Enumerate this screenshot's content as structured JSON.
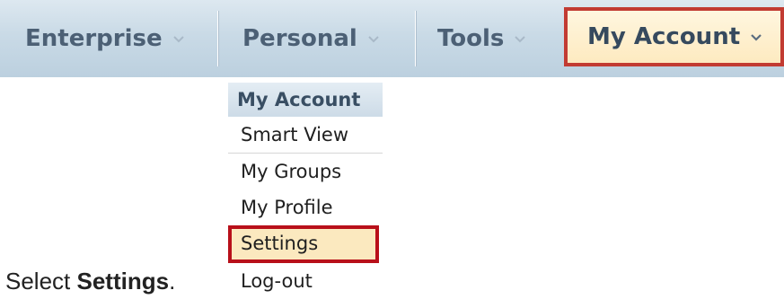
{
  "nav": {
    "tabs": [
      {
        "label": "Enterprise"
      },
      {
        "label": "Personal"
      },
      {
        "label": "Tools"
      },
      {
        "label": "My Account"
      }
    ]
  },
  "menu": {
    "header": "My Account",
    "items": [
      {
        "label": "Smart View"
      },
      {
        "label": "My Groups"
      },
      {
        "label": "My Profile"
      },
      {
        "label": "Settings"
      },
      {
        "label": "Log-out"
      }
    ]
  },
  "caption": {
    "prefix": "Select ",
    "bold": "Settings",
    "suffix": "."
  },
  "colors": {
    "highlight_border": "#c23b32",
    "highlight_fill": "#fdeac0",
    "nav_text": "#4c6075"
  },
  "icons": {
    "dropdown": "chevron-down-icon"
  }
}
